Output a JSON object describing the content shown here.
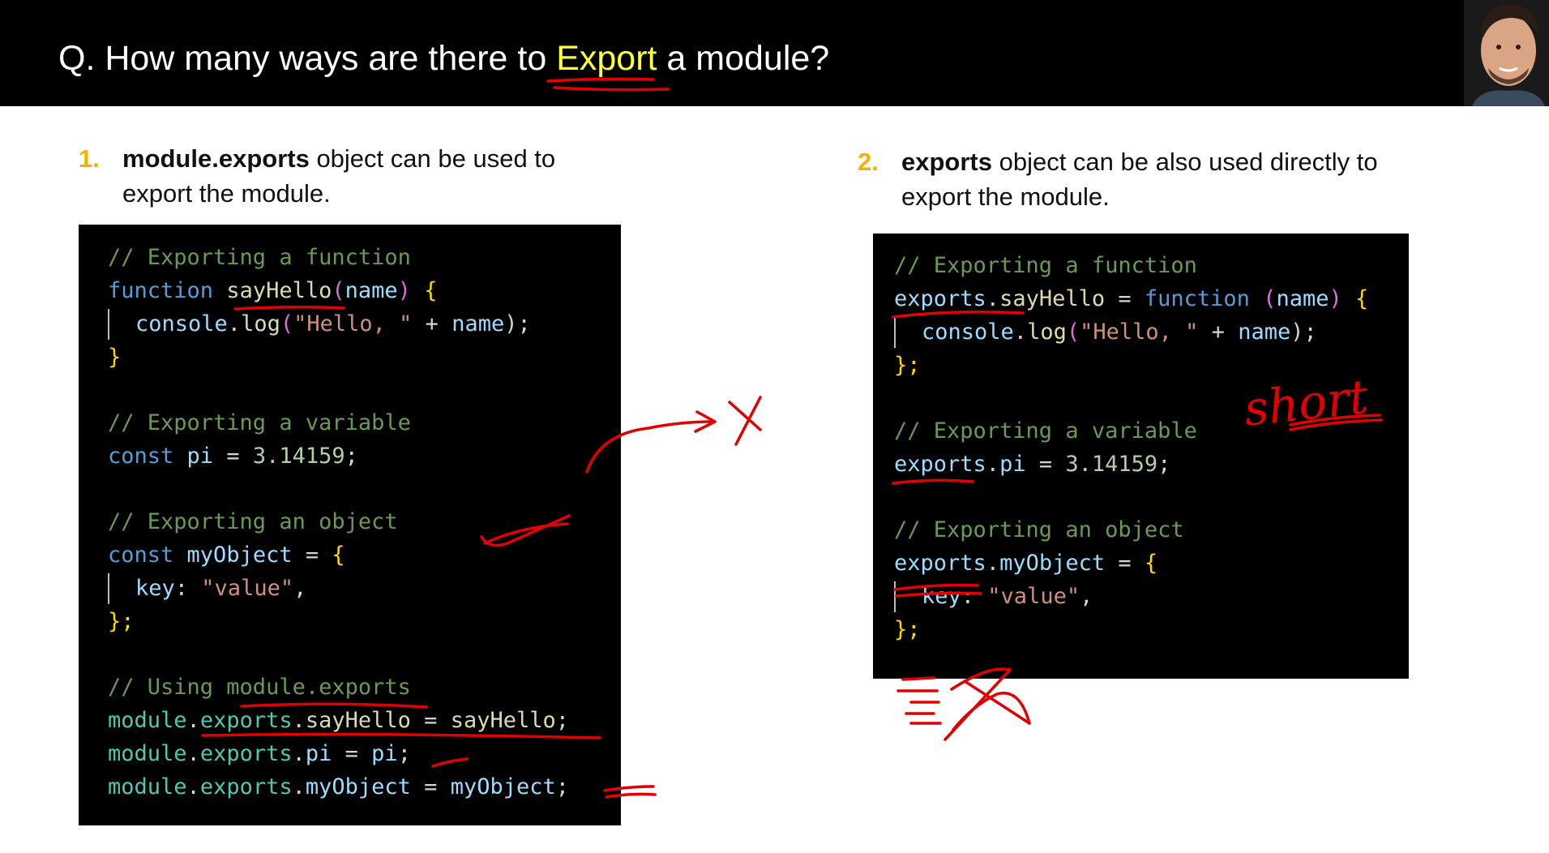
{
  "header": {
    "title_prefix": "Q. How many ways are there to ",
    "title_highlight": "Export",
    "title_suffix": " a module?"
  },
  "points": [
    {
      "number": "1.",
      "bold": "module.exports",
      "rest_line1": " object can be used to",
      "line2": "export the module."
    },
    {
      "number": "2.",
      "bold": "exports",
      "rest_line1": " object can be also used directly to",
      "line2": "export the module."
    }
  ],
  "code_left": {
    "c1": "// Exporting a function",
    "l2_kw": "function",
    "l2_fn": "sayHello",
    "l2_p": "(",
    "l2_arg": "name",
    "l2_p2": ")",
    "l2_br": "{",
    "l3_obj": "console",
    "l3_dot": ".",
    "l3_fn": "log",
    "l3_p": "(",
    "l3_str": "\"Hello, \"",
    "l3_op": " + ",
    "l3_var": "name",
    "l3_end": ");",
    "l4": "}",
    "c2": "// Exporting a variable",
    "l6_kw": "const",
    "l6_var": "pi",
    "l6_op": " = ",
    "l6_num": "3.14159",
    "l6_end": ";",
    "c3": "// Exporting an object",
    "l8_kw": "const",
    "l8_var": "myObject",
    "l8_op": " = ",
    "l8_br": "{",
    "l9_key": "key",
    "l9_colon": ": ",
    "l9_str": "\"value\"",
    "l9_end": ",",
    "l10": "};",
    "c4": "// Using module.exports",
    "l12_a": "module",
    "l12_b": "exports",
    "l12_c": "sayHello",
    "l12_op": " = ",
    "l12_d": "sayHello",
    "l12_end": ";",
    "l13_a": "module",
    "l13_b": "exports",
    "l13_c": "pi",
    "l13_op": " = ",
    "l13_d": "pi",
    "l13_end": ";",
    "l14_a": "module",
    "l14_b": "exports",
    "l14_c": "myObject",
    "l14_op": " = ",
    "l14_d": "myObject",
    "l14_end": ";",
    "dot": "."
  },
  "code_right": {
    "c1": "// Exporting a function",
    "l2_a": "exports",
    "l2_dot": ".",
    "l2_fn": "sayHello",
    "l2_op": " = ",
    "l2_kw": "function",
    "l2_p": " (",
    "l2_arg": "name",
    "l2_p2": ")",
    "l2_br": " {",
    "l3_obj": "console",
    "l3_dot": ".",
    "l3_fn": "log",
    "l3_p": "(",
    "l3_str": "\"Hello, \"",
    "l3_op": " + ",
    "l3_var": "name",
    "l3_end": ");",
    "l4": "};",
    "c2": "// Exporting a variable",
    "l6_a": "exports",
    "l6_dot": ".",
    "l6_var": "pi",
    "l6_op": " = ",
    "l6_num": "3.14159",
    "l6_end": ";",
    "c3": "// Exporting an object",
    "l8_a": "exports",
    "l8_dot": ".",
    "l8_var": "myObject",
    "l8_op": " = ",
    "l8_br": "{",
    "l9_key": "key",
    "l9_colon": ": ",
    "l9_str": "\"value\"",
    "l9_end": ",",
    "l10": "};"
  },
  "annotations": {
    "handwritten_word": "short"
  },
  "colors": {
    "accent_yellow": "#ffff33",
    "number_orange": "#f0b400",
    "ink_red": "#e00000"
  },
  "icons": [
    "presenter-avatar"
  ]
}
